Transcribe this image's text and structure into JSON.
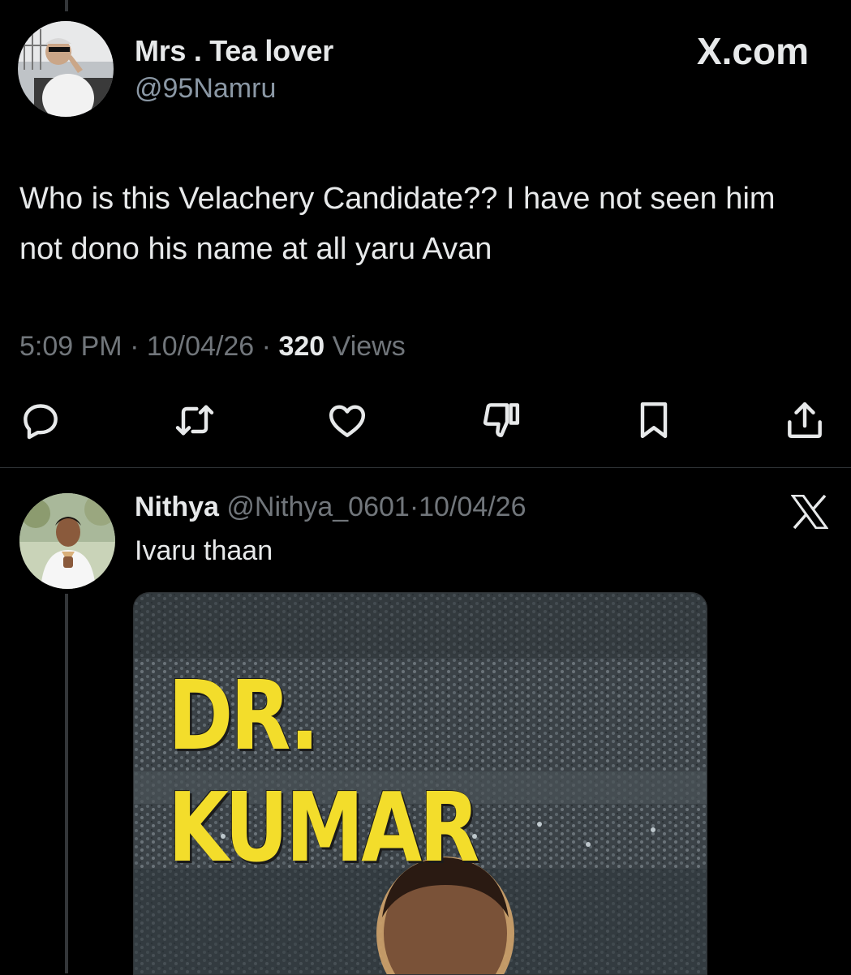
{
  "tweet": {
    "author_name": "Mrs . Tea lover",
    "author_handle": "@95Namru",
    "brand": "X.com",
    "text": "Who is this Velachery Candidate?? I have not seen him not dono his name at all yaru Avan",
    "time": "5:09 PM",
    "sep": "·",
    "date": "10/04/26",
    "views_count": "320",
    "views_label": "Views"
  },
  "actions": [
    {
      "icon": "reply-icon"
    },
    {
      "icon": "retweet-icon"
    },
    {
      "icon": "like-icon"
    },
    {
      "icon": "dislike-icon"
    },
    {
      "icon": "bookmark-icon"
    },
    {
      "icon": "share-icon"
    }
  ],
  "reply": {
    "author_name": "Nithya",
    "author_handle": "@Nithya_0601",
    "sep": "·",
    "date": "10/04/26",
    "text": "Ivaru thaan",
    "brand_icon": "x-logo-icon",
    "media_title": "DR. KUMAR"
  },
  "colors": {
    "background": "#000000",
    "text": "#e7e9ea",
    "muted": "#71767b",
    "divider": "#2f3336",
    "media_title": "#f3dd2b"
  }
}
